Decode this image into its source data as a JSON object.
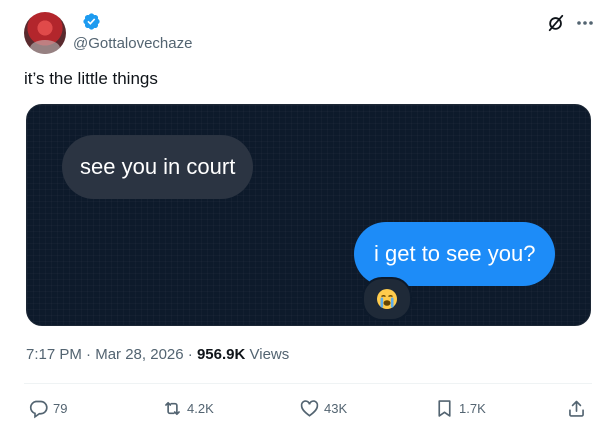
{
  "header": {
    "handle": "@Gottalovechaze",
    "icons": [
      "avatar",
      "verified-badge-icon",
      "grok-icon",
      "more-icon"
    ]
  },
  "tweet": {
    "text": "it’s the little things"
  },
  "media": {
    "left_bubble_text": "see you in court",
    "right_bubble_text": "i get to see you?",
    "reaction": "😭"
  },
  "meta": {
    "time": "7:17 PM",
    "separator": "·",
    "date": "Mar 28, 2026",
    "views_count": "956.9K",
    "views_label": "Views"
  },
  "actions": {
    "replies": "79",
    "reposts": "4.2K",
    "likes": "43K",
    "bookmarks": "1.7K"
  },
  "colors": {
    "accent": "#1d9bf0",
    "sent_bubble": "#1d8cf8",
    "received_bubble": "#2b3442",
    "muted_text": "#536471"
  }
}
